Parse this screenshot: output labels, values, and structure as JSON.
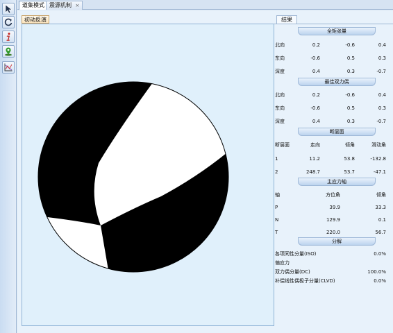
{
  "tabs": [
    {
      "label": "道集模式",
      "active": true
    },
    {
      "label": "震源机制",
      "active": false
    }
  ],
  "tab_close_glyph": "×",
  "toolbar_icons": [
    "pointer-icon",
    "rotate-icon",
    "info-icon",
    "location-pin-icon",
    "chart-icon"
  ],
  "plot": {
    "tab_label": "初动反演",
    "colors": {
      "compressional": "#000000",
      "dilatational": "#ffffff"
    }
  },
  "results": {
    "tab_label": "结果",
    "moment_tensor": {
      "title": "全矩张量",
      "rows": [
        {
          "label": "北向",
          "v": [
            "0.2",
            "-0.6",
            "0.4"
          ]
        },
        {
          "label": "东向",
          "v": [
            "-0.6",
            "0.5",
            "0.3"
          ]
        },
        {
          "label": "深度",
          "v": [
            "0.4",
            "0.3",
            "-0.7"
          ]
        }
      ]
    },
    "double_couple": {
      "title": "最佳双力偶",
      "rows": [
        {
          "label": "北向",
          "v": [
            "0.2",
            "-0.6",
            "0.4"
          ]
        },
        {
          "label": "东向",
          "v": [
            "-0.6",
            "0.5",
            "0.3"
          ]
        },
        {
          "label": "深度",
          "v": [
            "0.4",
            "0.3",
            "-0.7"
          ]
        }
      ]
    },
    "fault_planes": {
      "title": "断层面",
      "headers": [
        "断层面",
        "走向",
        "倾角",
        "滑动角"
      ],
      "rows": [
        {
          "label": "1",
          "v": [
            "11.2",
            "53.8",
            "-132.8"
          ]
        },
        {
          "label": "2",
          "v": [
            "248.7",
            "53.7",
            "-47.1"
          ]
        }
      ]
    },
    "principal_axes": {
      "title": "主应力轴",
      "headers": [
        "轴",
        "方位角",
        "倾角"
      ],
      "rows": [
        {
          "label": "P",
          "v": [
            "39.9",
            "33.3"
          ]
        },
        {
          "label": "N",
          "v": [
            "129.9",
            "0.1"
          ]
        },
        {
          "label": "T",
          "v": [
            "220.0",
            "56.7"
          ]
        }
      ]
    },
    "decomposition": {
      "title": "分解",
      "rows": [
        {
          "label": "各项同性分量(ISO)",
          "value": "0.0%"
        },
        {
          "label": "偏应力",
          "value": ""
        },
        {
          "label": "双力偶分量(DC)",
          "value": "100.0%"
        },
        {
          "label": "补偿线性偶极子分量(CLVD)",
          "value": "0.0%"
        }
      ]
    }
  }
}
